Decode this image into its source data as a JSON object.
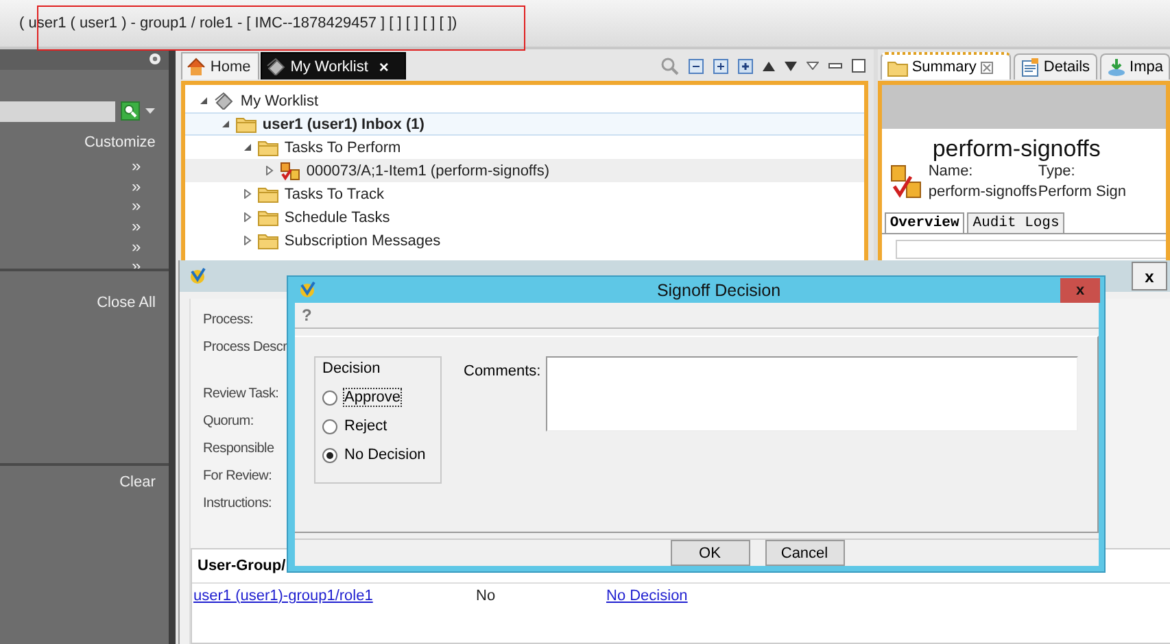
{
  "window": {
    "title": "( user1 ( user1 ) - group1 / role1 - [ IMC--1878429457 ] [ ] [ ] [ ]  [ ])",
    "highlighted": true
  },
  "sidebar": {
    "link": "Customize",
    "chevrons": [
      "»",
      "»",
      "»",
      "»",
      "»",
      "»"
    ],
    "close_all": "Close All",
    "clear": "Clear"
  },
  "editor_tabs": [
    {
      "label": "Home",
      "kind": "home",
      "selected": false
    },
    {
      "label": "My Worklist",
      "kind": "worklist",
      "selected": true,
      "close": "×"
    }
  ],
  "worklist_tree": [
    {
      "label": "My Worklist",
      "kind": "worklist",
      "bold": false,
      "expanded": true,
      "selected": false,
      "hovered": false,
      "children": [
        {
          "label": "user1 (user1) Inbox (1)",
          "kind": "folder",
          "bold": true,
          "expanded": true,
          "selected": true,
          "hovered": false,
          "children": [
            {
              "label": "Tasks To Perform",
              "kind": "folder",
              "bold": false,
              "expanded": true,
              "selected": false,
              "hovered": false,
              "children": [
                {
                  "label": "000073/A;1-Item1 (perform-signoffs)",
                  "kind": "task",
                  "bold": false,
                  "expanded": false,
                  "selected": false,
                  "hovered": true
                }
              ]
            },
            {
              "label": "Tasks To Track",
              "kind": "folder",
              "bold": false,
              "expanded": false,
              "selected": false,
              "hovered": false
            },
            {
              "label": "Schedule Tasks",
              "kind": "folder",
              "bold": false,
              "expanded": false,
              "selected": false,
              "hovered": false
            },
            {
              "label": "Subscription Messages",
              "kind": "folder",
              "bold": false,
              "expanded": false,
              "selected": false,
              "hovered": false
            }
          ]
        }
      ]
    }
  ],
  "summary": {
    "tabs": [
      {
        "label": "Summary",
        "kind": "summary",
        "selected": true
      },
      {
        "label": "Details",
        "kind": "details",
        "selected": false
      },
      {
        "label": "Impa",
        "kind": "impact",
        "selected": false
      }
    ],
    "heading": "perform-signoffs",
    "fields": [
      {
        "label": "Name:",
        "value": "perform-signoffs"
      },
      {
        "label": "Type:",
        "value": "Perform Sign"
      }
    ],
    "subtabs": [
      {
        "label": "Overview",
        "selected": true
      },
      {
        "label": "Audit Logs",
        "selected": false
      }
    ]
  },
  "perform_signoff_dialog": {
    "close": "x",
    "labels": [
      "Process:",
      "Process Descr",
      "Review Task:",
      "Quorum:",
      "Responsible",
      "For Review:",
      "Instructions:"
    ],
    "table": {
      "columns": [
        "User-Group/"
      ],
      "rows": [
        {
          "cells": [
            {
              "text": "user1 (user1)-group1/role1",
              "link": true
            },
            {
              "text": "No",
              "link": false
            },
            {
              "text": "No Decision",
              "link": true
            }
          ]
        }
      ]
    }
  },
  "signoff_dialog": {
    "title": "Signoff Decision",
    "close": "x",
    "help": "?",
    "decision": {
      "legend": "Decision",
      "options": [
        {
          "label": "Approve",
          "selected": false,
          "focused": true
        },
        {
          "label": "Reject",
          "selected": false,
          "focused": false
        },
        {
          "label": "No Decision",
          "selected": true,
          "focused": false
        }
      ]
    },
    "comments_label": "Comments:",
    "buttons": [
      "OK",
      "Cancel"
    ]
  }
}
